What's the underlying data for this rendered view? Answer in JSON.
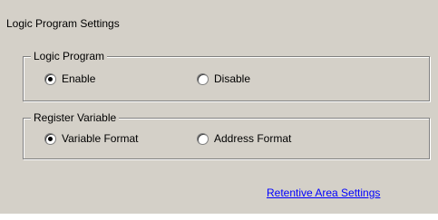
{
  "title": "Logic Program Settings",
  "logic_program": {
    "label": "Logic Program",
    "options": [
      {
        "label": "Enable",
        "checked": true
      },
      {
        "label": "Disable",
        "checked": false
      }
    ]
  },
  "register_variable": {
    "label": "Register Variable",
    "options": [
      {
        "label": "Variable Format",
        "checked": true
      },
      {
        "label": "Address Format",
        "checked": false
      }
    ]
  },
  "link": {
    "label": "Retentive Area Settings"
  }
}
